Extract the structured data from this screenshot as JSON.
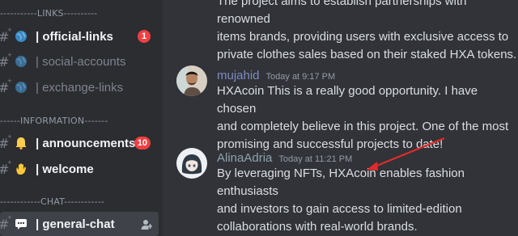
{
  "sidebar": {
    "dividers": {
      "links": "-----------LINKS----------",
      "information": "------INFORMATION-------",
      "chat": "------------CHAT------------"
    },
    "channels": [
      {
        "emoji": "globe-icon",
        "label": "| official-links",
        "badge": "1",
        "state": "unread"
      },
      {
        "emoji": "globe-icon",
        "label": "| social-accounts",
        "state": "muted"
      },
      {
        "emoji": "globe-icon",
        "label": "| exchange-links",
        "state": "muted"
      },
      {
        "emoji": "bell-icon",
        "label": "| announcements",
        "badge": "10",
        "state": "unread"
      },
      {
        "emoji": "waving-hand-icon",
        "label": "| welcome",
        "state": "unread"
      },
      {
        "emoji": "speech-bubble-icon",
        "label": "| general-chat",
        "state": "active"
      }
    ]
  },
  "messages": {
    "top_fragment": {
      "lines": [
        "The project aims to establish partnerships with renowned",
        "items brands, providing users with exclusive access to",
        "private clothes sales based on their staked HXA tokens."
      ]
    },
    "m1": {
      "author": "mujahid",
      "author_color": "#7e8cc5",
      "time": "Today at 9:17 PM",
      "lines": [
        "HXAcoin This is a really good opportunity. I have chosen",
        "and completely believe in this project. One of the most",
        "promising and successful projects to date!"
      ]
    },
    "m2": {
      "author": "AlinaAdria",
      "author_color": "#8da3ad",
      "time": "Today at 11:21 PM",
      "lines": [
        "By leveraging NFTs, HXAcoin enables fashion enthusiasts",
        "and investors to gain access to limited-edition",
        "collaborations with real-world brands."
      ]
    }
  },
  "colors": {
    "annotation_arrow": "#e02b2b",
    "badge": "#f23f42"
  }
}
